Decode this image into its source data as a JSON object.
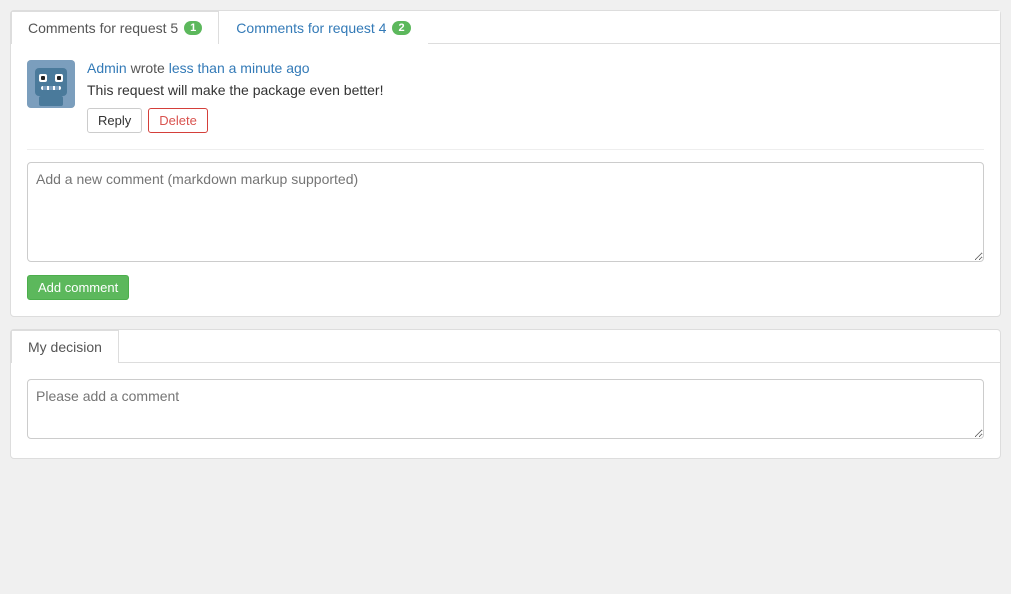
{
  "tabs": {
    "tab1": {
      "label": "Comments for request 5",
      "badge": "1"
    },
    "tab2": {
      "label": "Comments for request 4",
      "badge": "2"
    }
  },
  "comment": {
    "author": "Admin",
    "wrote": "wrote",
    "timestamp": "less than a minute ago",
    "text": "This request will make the package even better!",
    "reply_label": "Reply",
    "delete_label": "Delete"
  },
  "new_comment": {
    "placeholder": "Add a new comment (markdown markup supported)",
    "add_button": "Add comment"
  },
  "decision": {
    "tab_label": "My decision",
    "placeholder": "Please add a comment"
  }
}
